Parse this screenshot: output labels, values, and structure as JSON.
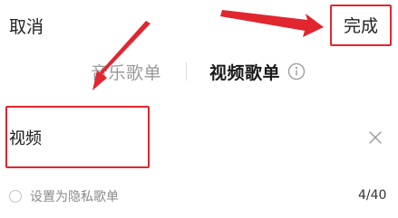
{
  "header": {
    "cancel_label": "取消",
    "done_label": "完成"
  },
  "tabs": {
    "music_label": "音乐歌单",
    "video_label": "视频歌单",
    "active": "视频歌单",
    "info_icon": "info-icon"
  },
  "form": {
    "name_value": "视频",
    "clear_icon": "close-icon",
    "private_label": "设置为隐私歌单",
    "private_checked": false,
    "counter": "4/40"
  },
  "annotations": {
    "color": "#e0262f"
  }
}
